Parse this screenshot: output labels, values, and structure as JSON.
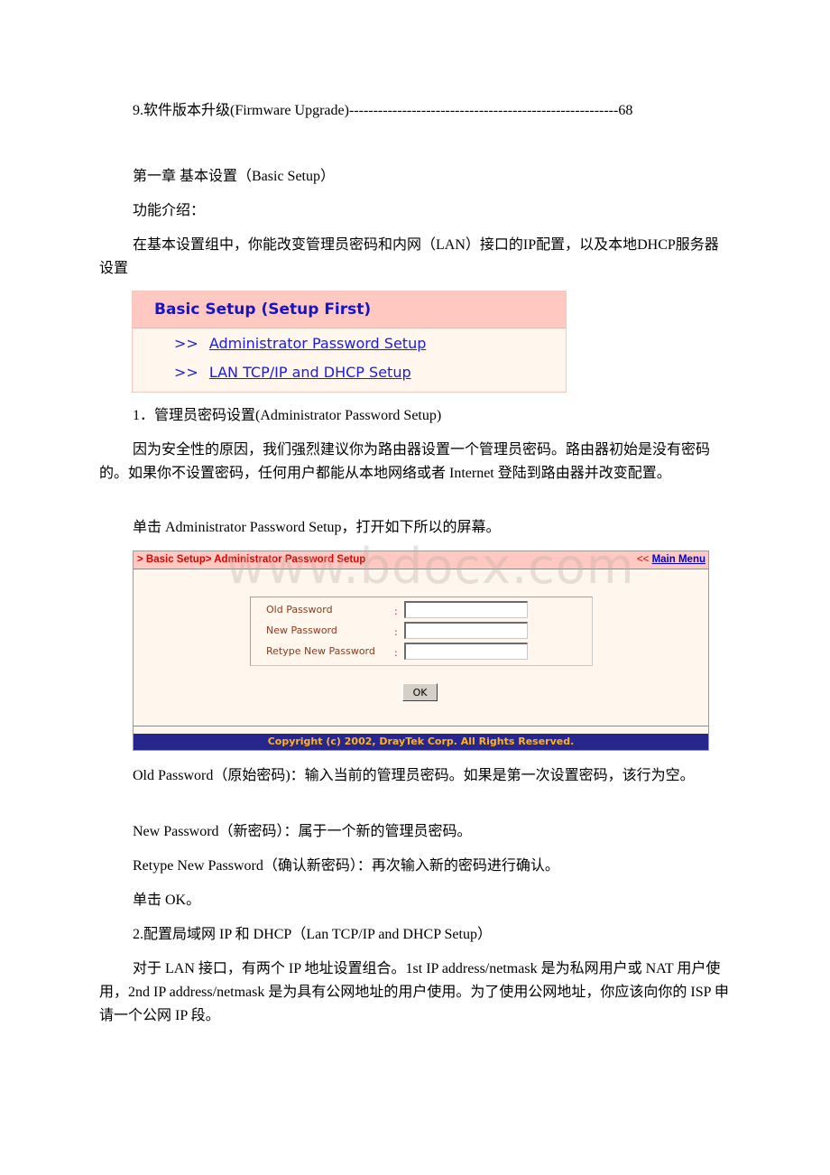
{
  "toc": {
    "entry": "9.软件版本升级(Firmware Upgrade)",
    "leader": "--------------------------------------------------------",
    "page": "68"
  },
  "chapter_title": "第一章 基本设置（Basic Setup）",
  "intro_label": "功能介绍：",
  "intro_text": "在基本设置组中，你能改变管理员密码和内网（LAN）接口的IP配置，以及本地DHCP服务器设置",
  "menu": {
    "title": "Basic Setup (Setup First)",
    "arrow": ">>",
    "items": [
      {
        "label": "Administrator Password Setup"
      },
      {
        "label": "LAN TCP/IP and DHCP Setup"
      }
    ]
  },
  "section1": {
    "title": "1．管理员密码设置(Administrator Password Setup)",
    "para1": "因为安全性的原因，我们强烈建议你为路由器设置一个管理员密码。路由器初始是没有密码的。如果你不设置密码，任何用户都能从本地网络或者 Internet 登陆到路由器并改变配置。",
    "para2": "单击 Administrator Password Setup，打开如下所以的屏幕。"
  },
  "password_window": {
    "breadcrumb": "> Basic Setup> Administrator Password Setup",
    "back_prefix": "<<",
    "main_menu": "Main Menu",
    "fields": [
      {
        "label": "Old Password",
        "value": ""
      },
      {
        "label": "New Password",
        "value": ""
      },
      {
        "label": "Retype New Password",
        "value": ""
      }
    ],
    "colon": ":",
    "ok": "OK",
    "footer": "Copyright (c) 2002, DrayTek Corp. All Rights Reserved."
  },
  "watermark": "www.bdocx.com",
  "desc": {
    "old": "Old Password（原始密码)：输入当前的管理员密码。如果是第一次设置密码，该行为空。",
    "new": "New Password（新密码）：属于一个新的管理员密码。",
    "retype": "Retype New Password（确认新密码）：再次输入新的密码进行确认。",
    "click_ok": "单击 OK。"
  },
  "section2": {
    "title": "2.配置局域网 IP 和 DHCP（Lan TCP/IP and DHCP Setup）",
    "para": "对于 LAN 接口，有两个 IP 地址设置组合。1st IP address/netmask 是为私网用户或 NAT 用户使用，2nd IP address/netmask 是为具有公网地址的用户使用。为了使用公网地址，你应该向你的 ISP 申请一个公网 IP 段。"
  }
}
